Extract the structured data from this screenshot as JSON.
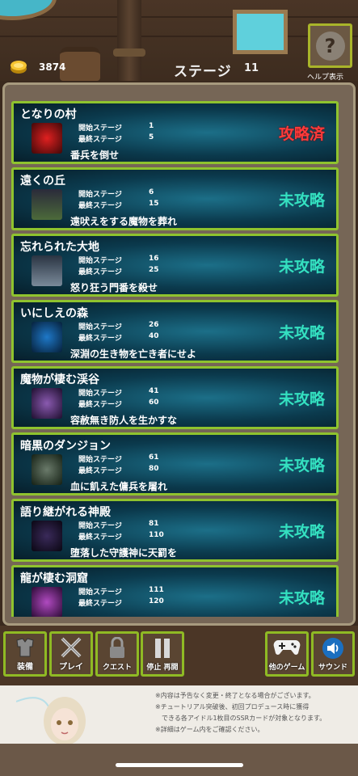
{
  "header": {
    "coins": "3874",
    "stage_label": "ステージ",
    "stage_number": "11",
    "help_label": "ヘルプ表示",
    "help_glyph": "?"
  },
  "stages": [
    {
      "name": "となりの村",
      "start_label": "開始ステージ",
      "start": "1",
      "end_label": "最終ステージ",
      "end": "5",
      "desc": "番兵を倒せ",
      "status": "攻略済",
      "thumb_color": "#a01818"
    },
    {
      "name": "遠くの丘",
      "start_label": "開始ステージ",
      "start": "6",
      "end_label": "最終ステージ",
      "end": "15",
      "desc": "遠吠えをする魔物を葬れ",
      "status": "未攻略",
      "thumb_color": "#3a4a3a"
    },
    {
      "name": "忘れられた大地",
      "start_label": "開始ステージ",
      "start": "16",
      "end_label": "最終ステージ",
      "end": "25",
      "desc": "怒り狂う門番を殺せ",
      "status": "未攻略",
      "thumb_color": "#4a5868"
    },
    {
      "name": "いにしえの森",
      "start_label": "開始ステージ",
      "start": "26",
      "end_label": "最終ステージ",
      "end": "40",
      "desc": "深淵の生き物を亡き者にせよ",
      "status": "未攻略",
      "thumb_color": "#0c3a66"
    },
    {
      "name": "魔物が棲む渓谷",
      "start_label": "開始ステージ",
      "start": "41",
      "end_label": "最終ステージ",
      "end": "60",
      "desc": "容赦無き防人を生かすな",
      "status": "未攻略",
      "thumb_color": "#4a2a66"
    },
    {
      "name": "暗黒のダンジョン",
      "start_label": "開始ステージ",
      "start": "61",
      "end_label": "最終ステージ",
      "end": "80",
      "desc": "血に飢えた傭兵を屠れ",
      "status": "未攻略",
      "thumb_color": "#2f4a2a"
    },
    {
      "name": "語り継がれる神殿",
      "start_label": "開始ステージ",
      "start": "81",
      "end_label": "最終ステージ",
      "end": "110",
      "desc": "堕落した守護神に天罰を",
      "status": "未攻略",
      "thumb_color": "#2a1a44"
    },
    {
      "name": "龍が棲む洞窟",
      "start_label": "開始ステージ",
      "start": "111",
      "end_label": "最終ステージ",
      "end": "120",
      "desc": "",
      "status": "未攻略",
      "thumb_color": "#4a1a55"
    }
  ],
  "toolbar": {
    "equip": "装備",
    "play": "プレイ",
    "quest": "クエスト",
    "pause_resume": "停止 再開",
    "other_games": "他のゲーム",
    "sound": "サウンド"
  },
  "ad": {
    "lines": [
      "※内容は予告なく変更・終了となる場合がございます。",
      "※チュートリアル突破後、初回プロデュース時に獲得",
      "できる各アイドル1枚目のSSRカードが対象となります。",
      "※詳細はゲーム内をご確認ください。"
    ]
  },
  "colors": {
    "card_border": "#8fc32e",
    "status_done": "#ff3b3b",
    "status_todo": "#34e0c0"
  }
}
